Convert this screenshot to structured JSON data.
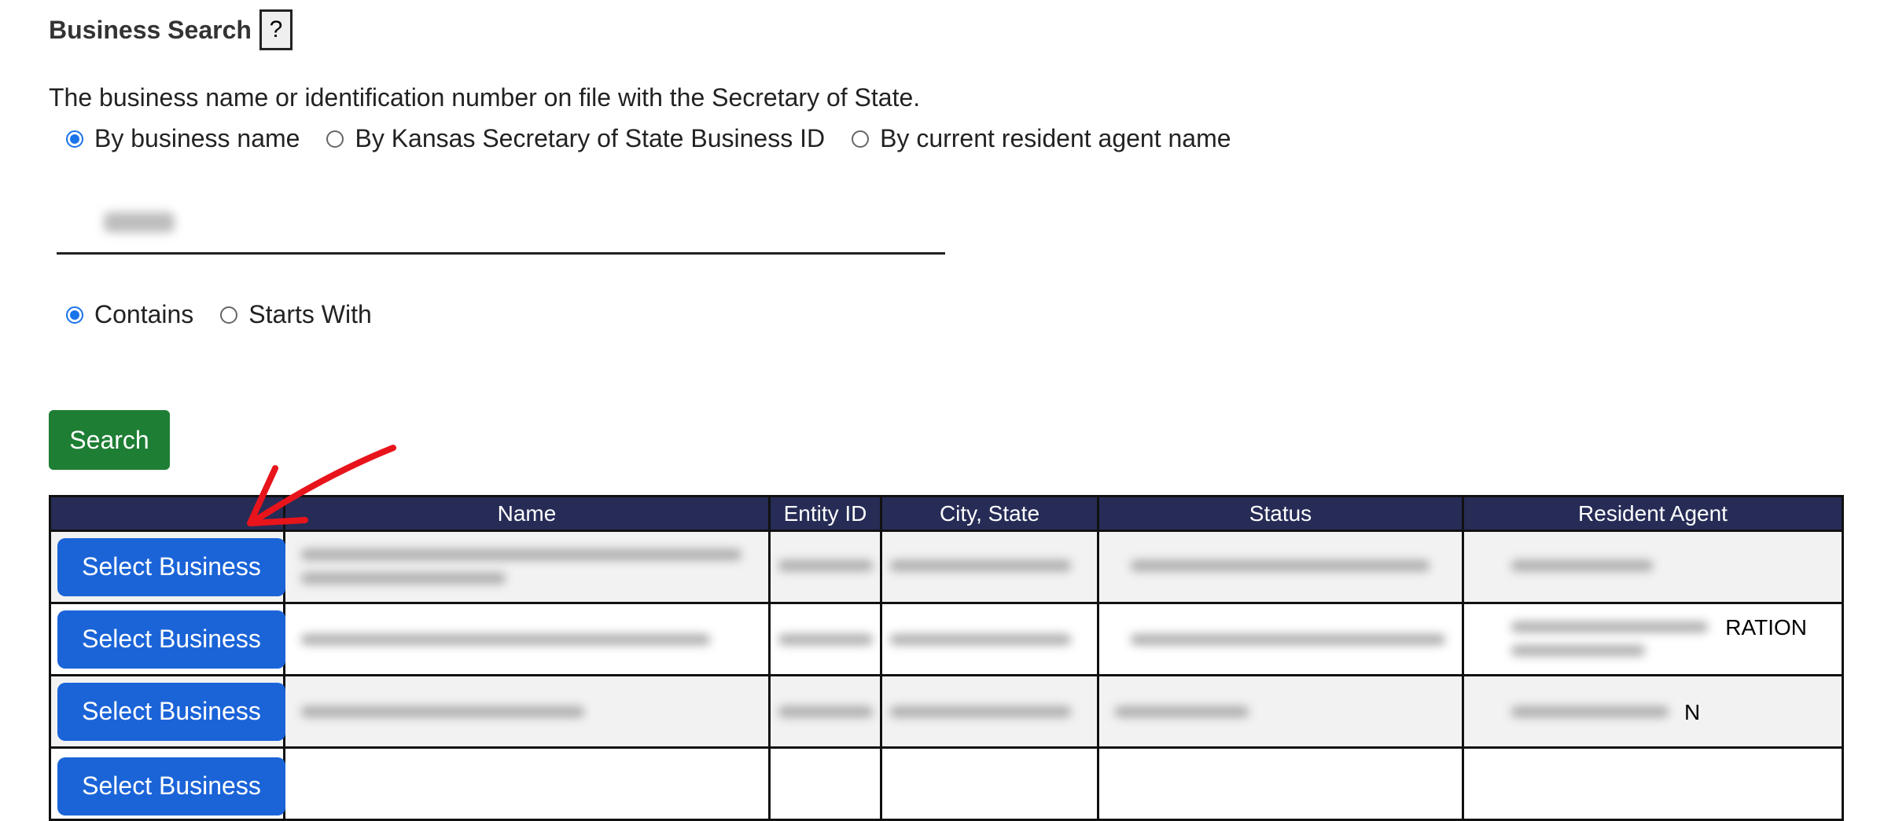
{
  "header": {
    "title": "Business Search",
    "help_label": "?"
  },
  "description": "The business name or identification number on file with the Secretary of State.",
  "search_by": {
    "options": [
      "By business name",
      "By Kansas Secretary of State Business ID",
      "By current resident agent name"
    ],
    "selected_index": 0
  },
  "search_input": {
    "value": ""
  },
  "match_mode": {
    "options": [
      "Contains",
      "Starts With"
    ],
    "selected_index": 0
  },
  "search_button_label": "Search",
  "results": {
    "columns": [
      "",
      "Name",
      "Entity ID",
      "City, State",
      "Status",
      "Resident Agent"
    ],
    "select_label": "Select Business",
    "rows": [
      {
        "agent_visible": ""
      },
      {
        "agent_visible": "RATION"
      },
      {
        "agent_visible": "N"
      }
    ]
  },
  "colors": {
    "header_bg": "#262c56",
    "select_button": "#1b64d8",
    "search_button": "#1e7e34",
    "annotation_arrow": "#e8141c"
  }
}
